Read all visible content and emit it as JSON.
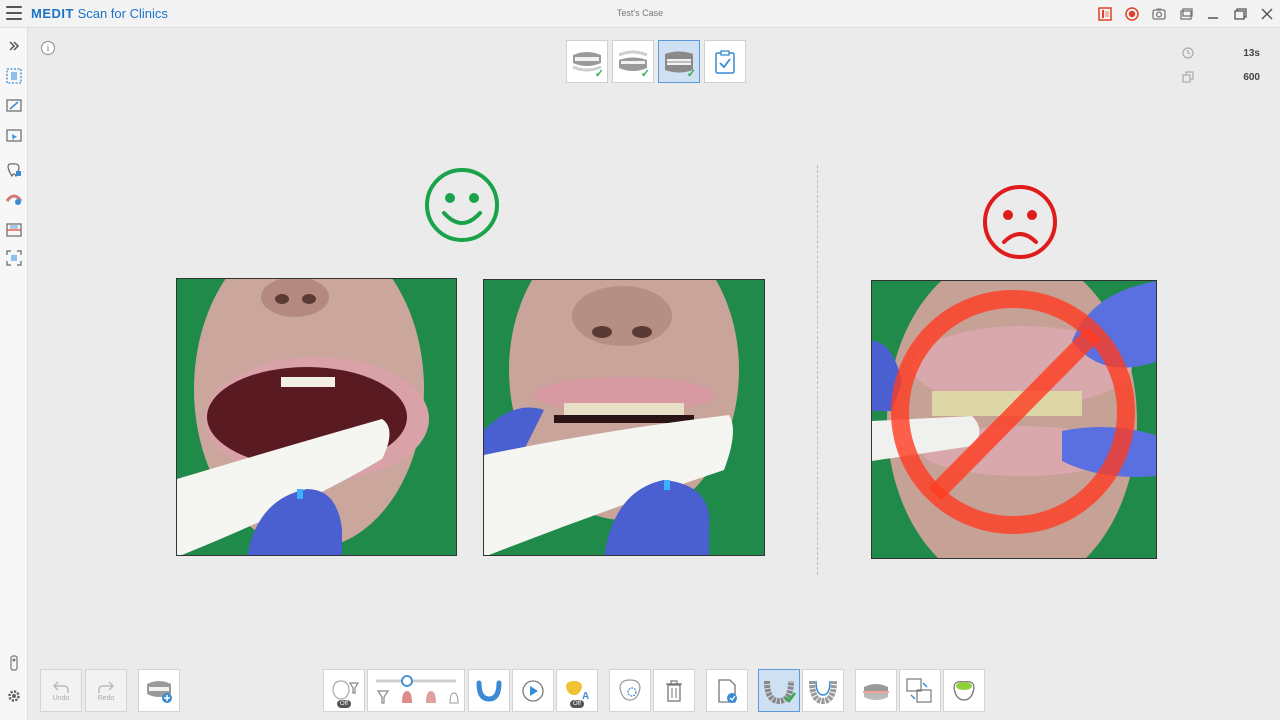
{
  "app": {
    "title_brand": "MEDIT",
    "title_rest": " Scan for Clinics",
    "case_title": "Test's Case"
  },
  "stats": {
    "time": "13s",
    "count": "600"
  },
  "stage_tabs": [
    {
      "name": "upper-jaw",
      "checked": true
    },
    {
      "name": "lower-jaw",
      "checked": true
    },
    {
      "name": "occlusion",
      "checked": true,
      "active": true
    },
    {
      "name": "review",
      "checked": false
    }
  ],
  "bottom_toolbar": {
    "undo_label": "Undo",
    "redo_label": "Redo",
    "off_label": "Off"
  },
  "colors": {
    "brand": "#1a73c9",
    "good": "#1aa34a",
    "bad": "#e01b1b",
    "check": "#2db04b",
    "active_tab": "#cfe0f2"
  }
}
